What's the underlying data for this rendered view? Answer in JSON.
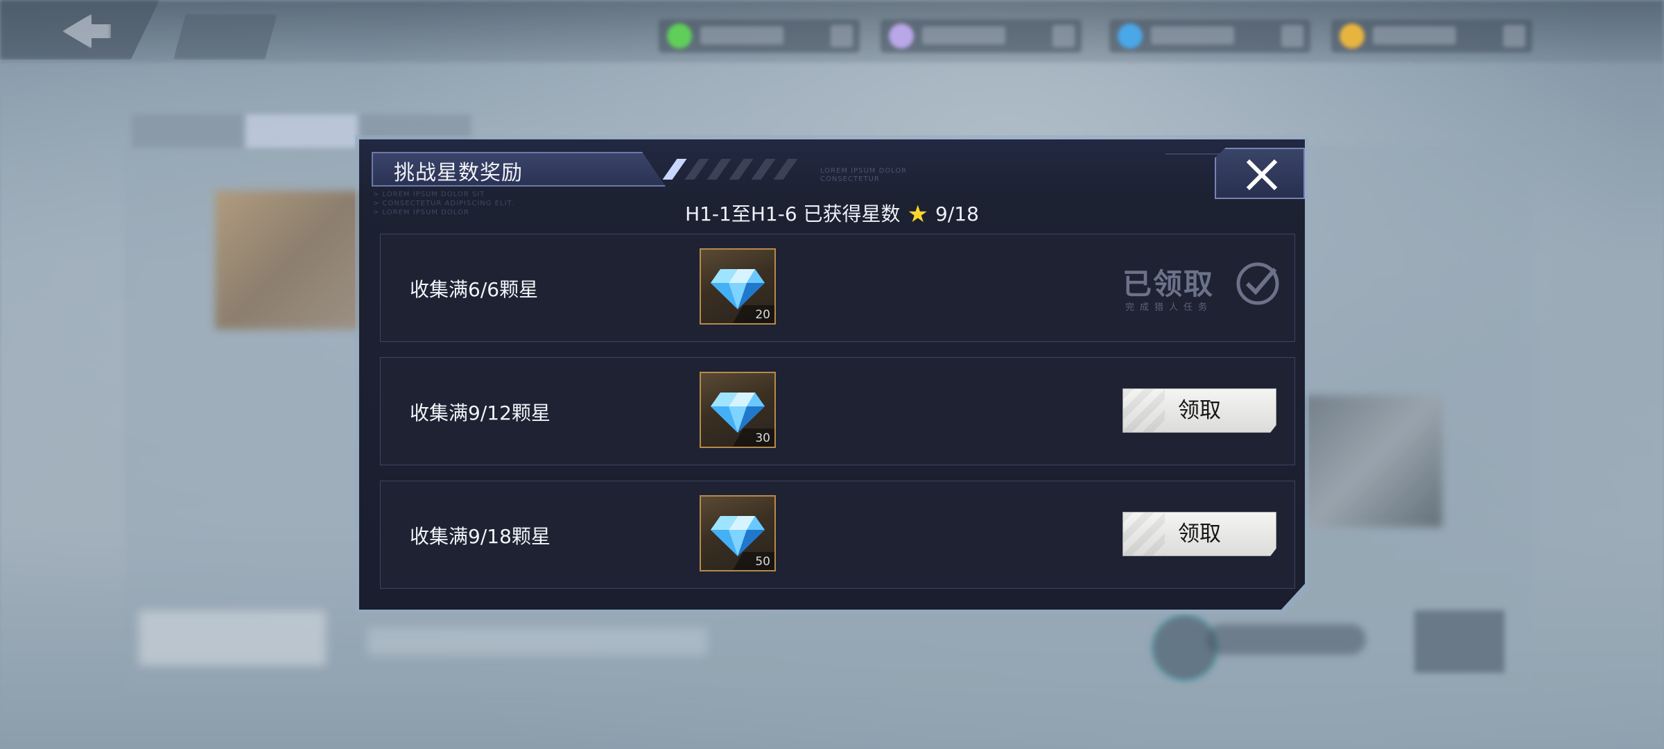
{
  "dialog": {
    "title": "挑战星数奖励",
    "deco_text": [
      "LOREM IPSUM DOLOR",
      "CONSECTETUR"
    ],
    "deco_left": [
      "> LOREM IPSUM DOLOR SIT",
      "> CONSECTETUR ADIPISCING ELIT.",
      "> LOREM IPSUM DOLOR"
    ],
    "summary": {
      "range": "H1-1至H1-6 已获得星数",
      "stars": "9/18",
      "star_color": "#ffd62e"
    },
    "rewards": [
      {
        "label": "收集满6/6颗星",
        "item_icon": "diamond-icon",
        "count": "20",
        "status": "claimed",
        "claimed_text": "已领取",
        "claimed_sub": "完成猎人任务"
      },
      {
        "label": "收集满9/12颗星",
        "item_icon": "diamond-icon",
        "count": "30",
        "status": "claimable",
        "button_label": "领取"
      },
      {
        "label": "收集满9/18颗星",
        "item_icon": "diamond-icon",
        "count": "50",
        "status": "claimable",
        "button_label": "领取"
      }
    ]
  },
  "colors": {
    "dialog_bg": "#1d2233",
    "frame": "#96acc4",
    "accent_gold": "#b98a4a",
    "diamond": "#3fb6ff"
  }
}
